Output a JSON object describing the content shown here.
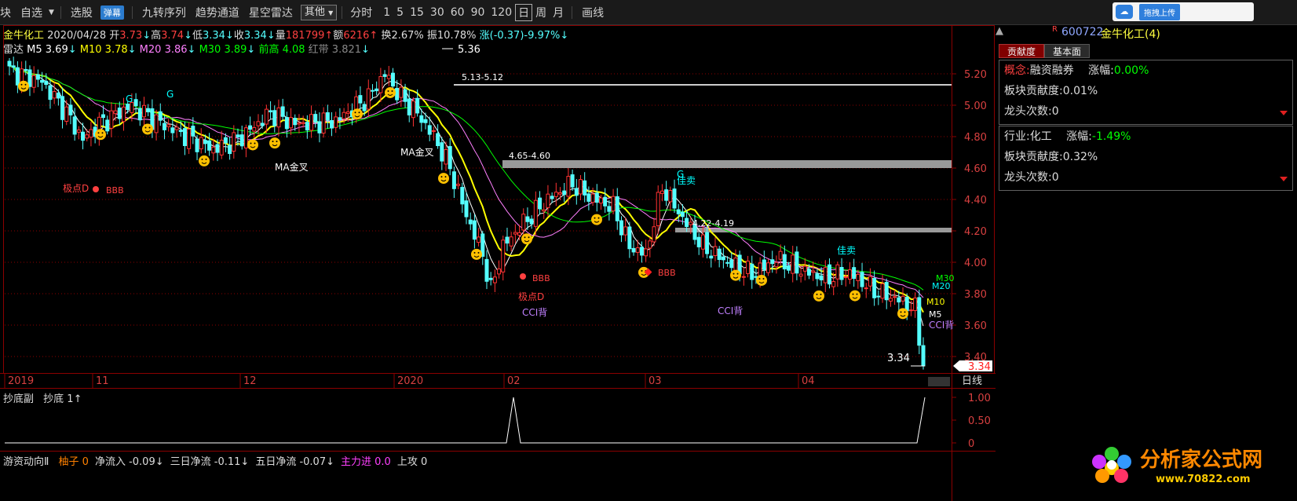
{
  "toolbar": {
    "items": [
      "块",
      "自选",
      "选股",
      "弹幕",
      "九转序列",
      "趋势通道",
      "星空雷达"
    ],
    "select_value": "其他",
    "periods": [
      "分时",
      "1",
      "5",
      "15",
      "30",
      "60",
      "90",
      "120",
      "日",
      "周",
      "月"
    ],
    "active_period": "日",
    "draw_label": "画线",
    "upload_label": "拖拽上传",
    "up_arrow": "▲",
    "r_mark": "R"
  },
  "info1": {
    "name": "金牛化工",
    "date": "2020/04/28",
    "open_l": "开",
    "open": "3.73",
    "high_l": "高",
    "high": "3.74",
    "low_l": "低",
    "low": "3.34",
    "close_l": "收",
    "close": "3.34",
    "vol_l": "量",
    "vol": "181799",
    "amt_l": "额",
    "amt": "6216",
    "turn": "换2.67%",
    "amp": "振10.78%",
    "chg": "涨(-0.37)-9.97%"
  },
  "info2": {
    "name": "雷达",
    "ma5": "M5 3.69",
    "ma10": "M10 3.78",
    "ma20": "M20 3.86",
    "ma30": "M30 3.89",
    "qiangao": "前高 4.08",
    "hongdai": "红带 3.821"
  },
  "chart_data": {
    "type": "candlestick",
    "y_ticks": [
      "5.20",
      "5.00",
      "4.80",
      "4.60",
      "4.40",
      "4.20",
      "4.00",
      "3.80",
      "3.60",
      "3.40"
    ],
    "x_ticks": [
      "2019",
      "11",
      "12",
      "2020",
      "02",
      "03",
      "04"
    ],
    "current_price": "3.34",
    "ylim": [
      3.3,
      5.45
    ],
    "labels": {
      "peak": "5.36",
      "low_end": "3.34",
      "zone1": "5.13-5.12",
      "zone2": "4.65-4.60",
      "zone3": "4.22-4.19",
      "jidian": "极点D",
      "bbb": "BBB",
      "cci": "CCI背",
      "jinjcha": "MA金叉",
      "jiamai": "佳卖",
      "g": "G",
      "m5": "M5",
      "m10": "M10",
      "m20": "M20",
      "m30": "M30",
      "rixian": "日线"
    },
    "colors": {
      "up": "#ff3232",
      "down": "#54ffff",
      "ma5": "#ffffff",
      "ma10": "#ffff00",
      "ma20": "#ff80ff",
      "ma30": "#00ff00",
      "grid": "#8b0000"
    }
  },
  "sub1": {
    "title": "抄底副",
    "indicator": "抄底 1",
    "y_ticks": [
      "1.00",
      "0.50",
      "0"
    ]
  },
  "sub2": {
    "title": "游资动向Ⅱ",
    "items": [
      {
        "label": "柚子",
        "value": "0",
        "color": "#ff8000"
      },
      {
        "label": "净流入",
        "value": "-0.09",
        "color": "#dddddd"
      },
      {
        "label": "三日净流",
        "value": "-0.11",
        "color": "#dddddd"
      },
      {
        "label": "五日净流",
        "value": "-0.07",
        "color": "#dddddd"
      },
      {
        "label": "主力进",
        "value": "0.0",
        "color": "#ff40ff"
      },
      {
        "label": "上攻",
        "value": "0",
        "color": "#dddddd"
      }
    ]
  },
  "right_panel": {
    "code": "600722",
    "name": "金牛化工(4)",
    "tabs": [
      "贡献度",
      "基本面"
    ],
    "concept": {
      "label": "概念:",
      "name": "融资融券",
      "chg_label": "涨幅:",
      "chg": "0.00%",
      "contrib": "板块贡献度:0.01%",
      "dragon": "龙头次数:0"
    },
    "industry": {
      "label": "行业:",
      "name": "化工",
      "chg_label": "涨幅:",
      "chg": "-1.49%",
      "contrib": "板块贡献度:0.32%",
      "dragon": "龙头次数:0"
    }
  },
  "watermark": {
    "text": "分析家公式网",
    "url": "www.70822.com"
  }
}
